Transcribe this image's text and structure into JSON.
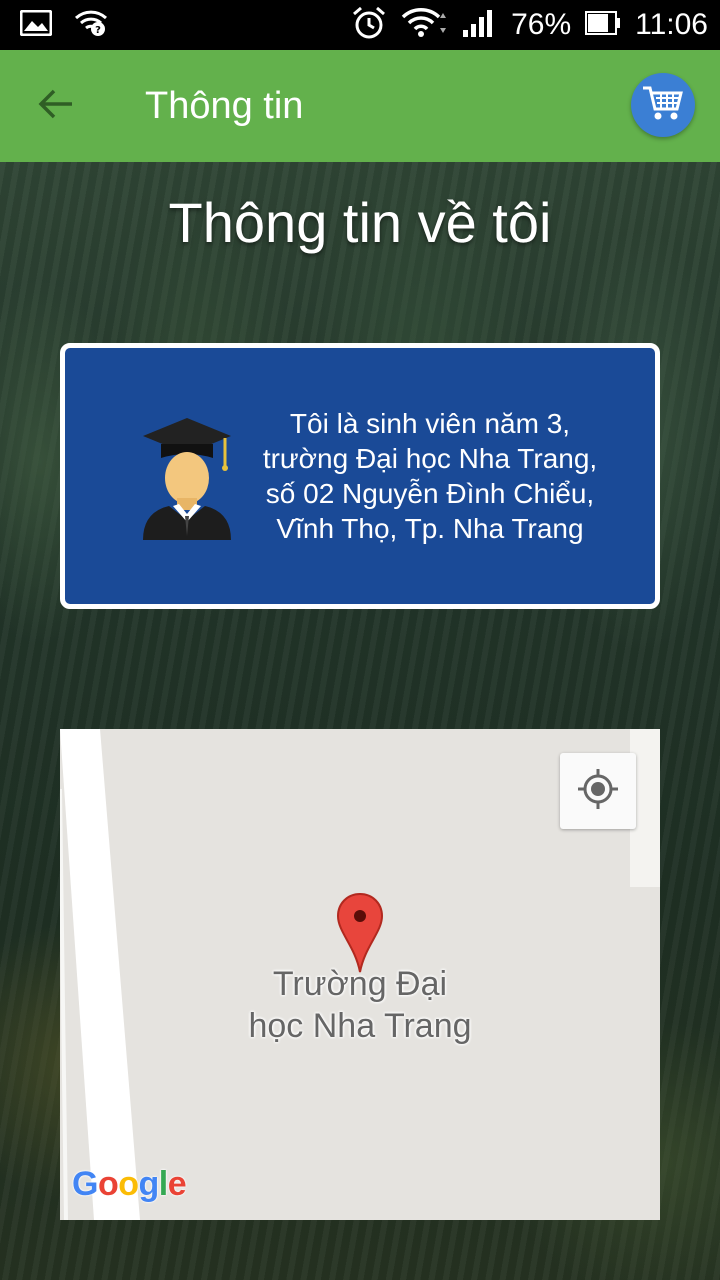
{
  "status_bar": {
    "battery": "76%",
    "time": "11:06",
    "icons": [
      "image-icon",
      "wifi-question-icon",
      "alarm-icon",
      "wifi-icon",
      "signal-icon",
      "battery-icon"
    ]
  },
  "app_bar": {
    "title": "Thông tin",
    "background": "#63b14c",
    "cart_color": "#3b7fd4"
  },
  "heading": "Thông tin về tôi",
  "info_card": {
    "lines": [
      "Tôi là sinh viên năm 3,",
      "trường Đại học Nha Trang,",
      "số 02 Nguyễn Đình Chiểu,",
      "Vĩnh Thọ, Tp. Nha Trang"
    ],
    "background": "#1a4a97"
  },
  "map": {
    "marker_label_lines": [
      "Trường Đại",
      "học Nha Trang"
    ],
    "logo": "Google",
    "marker_color": "#e8453c"
  }
}
